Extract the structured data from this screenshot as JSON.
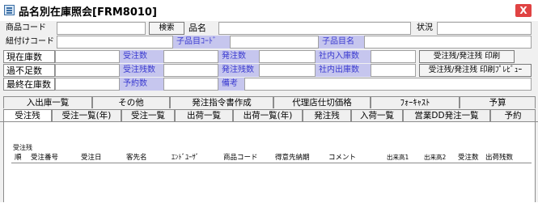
{
  "window": {
    "title": "品名別在庫照会[FRM8010]",
    "close": "X"
  },
  "row1": {
    "item_code_label": "商品コード",
    "search_button": "検索",
    "item_name_label": "品名",
    "status_label": "状況"
  },
  "row2": {
    "link_code_label": "紐付けコード",
    "sub_item_code_label": "子品目ｺｰﾄﾞ",
    "sub_item_name_label": "子品目名"
  },
  "stock": {
    "current_label": "現在庫数",
    "shortage_label": "過不足数",
    "final_label": "最終在庫数",
    "orders_received_label": "受注数",
    "orders_remaining_label": "受注残数",
    "reserved_label": "予約数",
    "orders_placed_label": "発注数",
    "orders_placed_remaining_label": "発注残数",
    "memo_label": "備考",
    "internal_in_label": "社内入庫数",
    "internal_out_label": "社内出庫数",
    "print_button": "受注残/発注残 印刷",
    "preview_button": "受注残/発注残 印刷ﾌﾟﾚﾋﾞｭｰ"
  },
  "tabs_row1": [
    "入出庫一覧",
    "その他",
    "発注指令書作成",
    "代理店仕切価格",
    "ﾌｫｰｷｬｽﾄ",
    "予算"
  ],
  "tabs_row2": [
    "受注残",
    "受注一覧(年)",
    "受注一覧",
    "出荷一覧",
    "出荷一覧(年)",
    "発注残",
    "入荷一覧",
    "営業DD発注一覧",
    "予約"
  ],
  "active_tab": "受注残",
  "panel": {
    "section_title": "受注残",
    "columns": [
      "順",
      "受注番号",
      "受注日",
      "客先名",
      "ｴﾝﾄﾞﾕｰｻﾞ",
      "商品コード",
      "得意先納期",
      "コメント",
      "出来高1",
      "出来高2",
      "受注数",
      "出荷残数"
    ]
  }
}
